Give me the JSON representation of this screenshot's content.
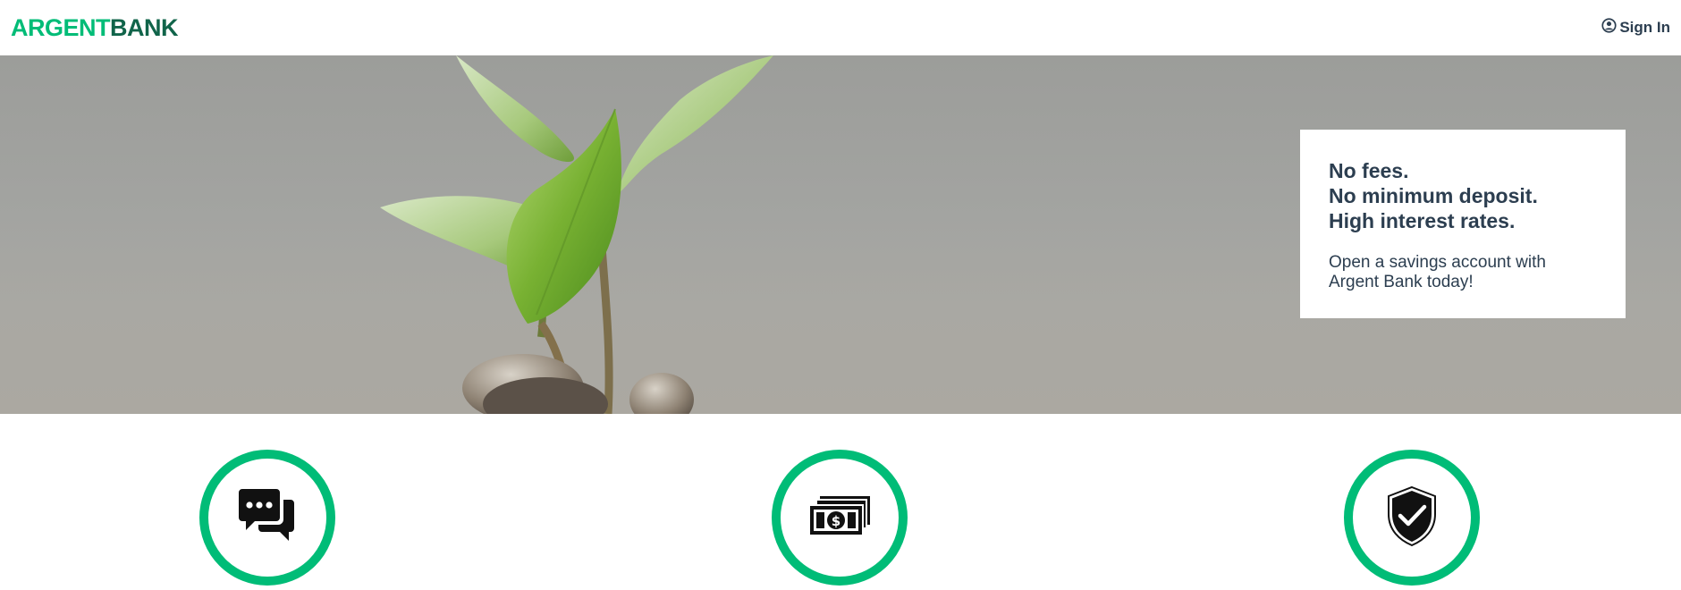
{
  "nav": {
    "logo_part_1": "ARGENT",
    "logo_part_2": "BANK",
    "signin_label": "Sign In",
    "signin_icon": "user-circle-icon"
  },
  "hero": {
    "subtitles": [
      "No fees.",
      "No minimum deposit.",
      "High interest rates."
    ],
    "text": "Open a savings account with Argent Bank today!"
  },
  "features": [
    {
      "icon": "chat-icon"
    },
    {
      "icon": "money-icon"
    },
    {
      "icon": "security-shield-icon"
    }
  ],
  "colors": {
    "accent": "#00bc77",
    "brand_dark": "#11644a",
    "text": "#2c3e50"
  }
}
